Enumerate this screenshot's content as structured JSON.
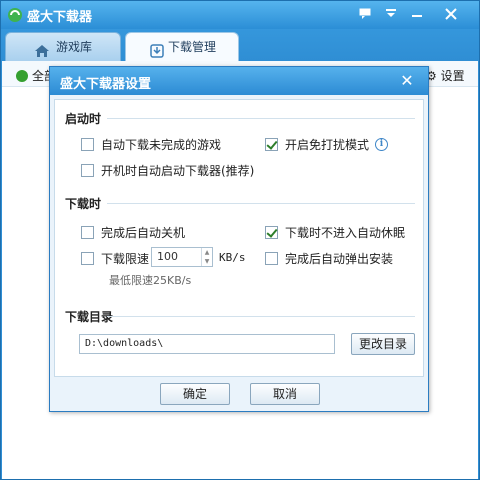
{
  "app": {
    "title": "盛大下载器",
    "tabs": [
      {
        "label": "游戏库"
      },
      {
        "label": "下载管理"
      }
    ],
    "toolbar": {
      "left_label": "全部",
      "right_label": "设置"
    }
  },
  "dialog": {
    "title": "盛大下载器设置",
    "close_glyph": "✕",
    "sections": {
      "startup": {
        "title": "启动时",
        "auto_download_unfinished": {
          "label": "自动下载未完成的游戏",
          "checked": false
        },
        "no_disturb_mode": {
          "label": "开启免打扰模式",
          "checked": true
        },
        "autostart_on_boot": {
          "label": "开机时自动启动下载器(推荐)",
          "checked": false
        }
      },
      "downloading": {
        "title": "下载时",
        "shutdown_after_complete": {
          "label": "完成后自动关机",
          "checked": false
        },
        "no_sleep_while_downloading": {
          "label": "下载时不进入自动休眠",
          "checked": true
        },
        "speed_limit": {
          "label": "下载限速",
          "checked": false,
          "value": "100",
          "unit": "KB/s"
        },
        "min_speed_note": "最低限速25KB/s",
        "auto_popup_install": {
          "label": "完成后自动弹出安装",
          "checked": false
        }
      },
      "directory": {
        "title": "下载目录",
        "path": "D:\\downloads\\",
        "change_button": "更改目录"
      }
    },
    "buttons": {
      "ok": "确定",
      "cancel": "取消"
    }
  }
}
